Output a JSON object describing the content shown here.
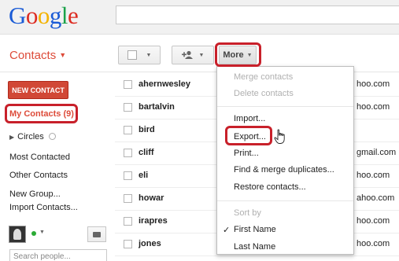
{
  "logo": {
    "letters": [
      "G",
      "o",
      "o",
      "g",
      "l",
      "e"
    ]
  },
  "header": {
    "search_value": ""
  },
  "title": {
    "label": "Contacts"
  },
  "toolbar": {
    "more_label": "More"
  },
  "sidebar": {
    "new_contact": "NEW CONTACT",
    "my_contacts": "My Contacts (9)",
    "circles": "Circles",
    "most_contacted": "Most Contacted",
    "other_contacts": "Other Contacts",
    "new_group": "New Group...",
    "import_contacts": "Import Contacts...",
    "search_placeholder": "Search people..."
  },
  "contacts": [
    {
      "name": "ahernwesley",
      "email": "hoo.com"
    },
    {
      "name": "bartalvin",
      "email": "hoo.com"
    },
    {
      "name": "bird",
      "email": ""
    },
    {
      "name": "cliff",
      "email": "gmail.com"
    },
    {
      "name": "eli",
      "email": "hoo.com"
    },
    {
      "name": "howar",
      "email": "ahoo.com"
    },
    {
      "name": "irapres",
      "email": "hoo.com"
    },
    {
      "name": "jones",
      "email": "hoo.com"
    }
  ],
  "menu": {
    "merge": "Merge contacts",
    "delete": "Delete contacts",
    "import": "Import...",
    "export": "Export...",
    "print": "Print...",
    "find_merge": "Find & merge duplicates...",
    "restore": "Restore contacts...",
    "sort_by": "Sort by",
    "first_name": "First Name",
    "last_name": "Last Name",
    "check_mark": "✓"
  },
  "colors": {
    "accent": "#dd4b39",
    "highlight": "#c8202a",
    "new_contact_bg": "#d14836"
  }
}
